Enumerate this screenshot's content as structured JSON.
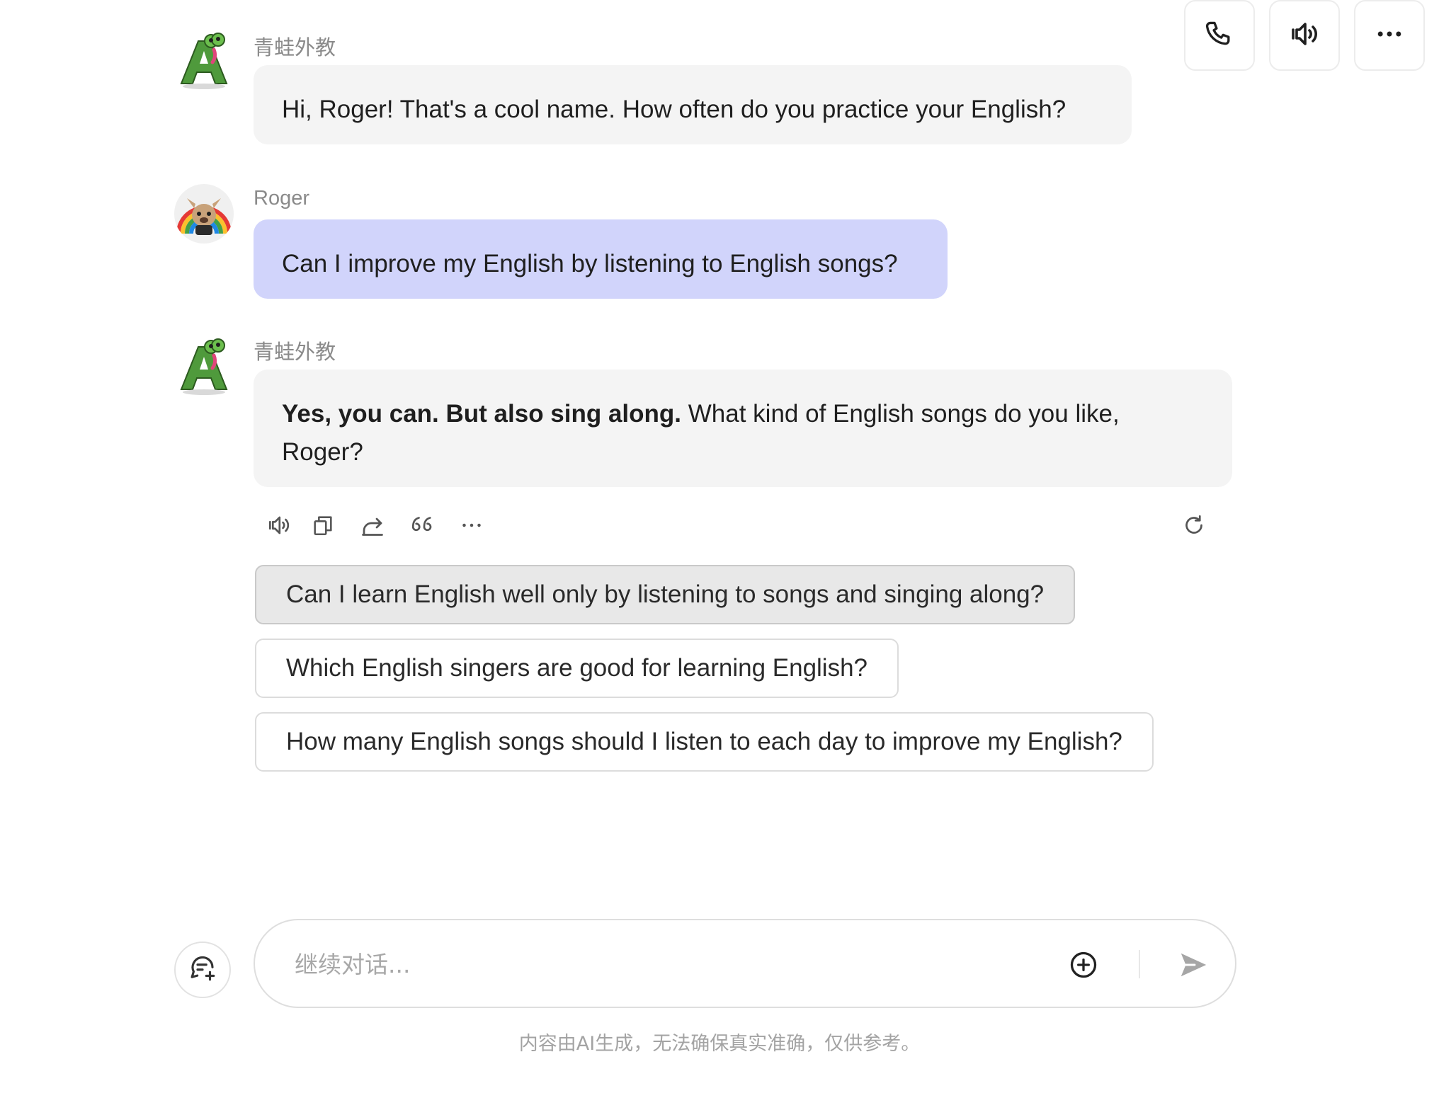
{
  "colors": {
    "user_bubble": "#d1d4fb",
    "bot_bubble": "#f4f4f4",
    "accent_send": "#9e9e9e"
  },
  "header": {
    "buttons": [
      {
        "icon": "phone-icon"
      },
      {
        "icon": "speaker-icon"
      },
      {
        "icon": "more-horizontal-icon"
      }
    ]
  },
  "messages": [
    {
      "sender": "青蛙外教",
      "role": "bot",
      "text": "Hi, Roger! That's a cool name. How often do you practice your English?"
    },
    {
      "sender": "Roger",
      "role": "user",
      "text": "Can I improve my English by listening to English songs?"
    },
    {
      "sender": "青蛙外教",
      "role": "bot",
      "text_bold": "Yes, you can. But also sing along.",
      "text_rest": " What kind of English songs do you like, Roger?"
    }
  ],
  "message_tools": [
    "speaker-icon",
    "copy-icon",
    "share-icon",
    "quote-icon",
    "more-icon",
    "refresh-icon"
  ],
  "suggestions": [
    "Can I learn English well only by listening to songs and singing along?",
    "Which English singers are good for learning English?",
    "How many English songs should I listen to each day to improve my English?"
  ],
  "composer": {
    "placeholder": "继续对话...",
    "value": ""
  },
  "disclaimer": "内容由AI生成，无法确保真实准确，仅供参考。"
}
